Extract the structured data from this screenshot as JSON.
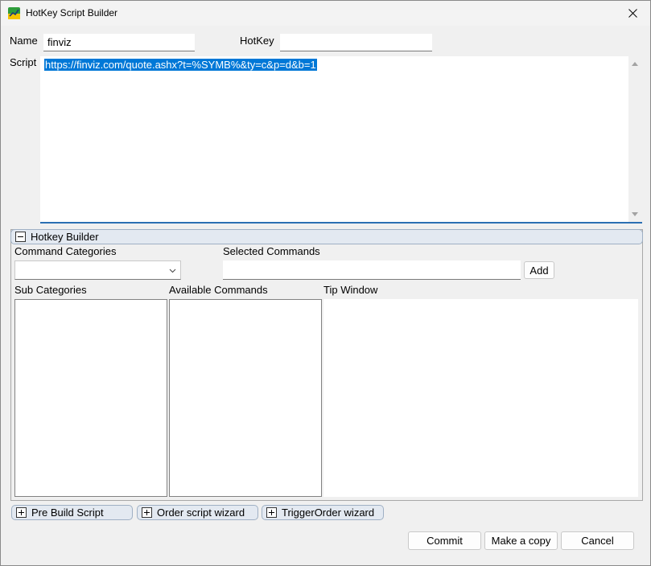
{
  "window": {
    "title": "HotKey Script Builder"
  },
  "form": {
    "name_label": "Name",
    "name_value": "finviz",
    "hotkey_label": "HotKey",
    "hotkey_value": "",
    "script_label": "Script",
    "script_value": "https://finviz.com/quote.ashx?t=%SYMB%&ty=c&p=d&b=1"
  },
  "builder": {
    "header_label": "Hotkey Builder",
    "command_categories_label": "Command Categories",
    "command_categories_selected": "",
    "selected_commands_label": "Selected Commands",
    "selected_commands_value": "",
    "add_label": "Add",
    "sub_categories_label": "Sub Categories",
    "available_commands_label": "Available Commands",
    "tip_window_label": "Tip Window"
  },
  "wizards": [
    {
      "label": "Pre Build Script"
    },
    {
      "label": "Order script wizard"
    },
    {
      "label": "TriggerOrder wizard"
    }
  ],
  "footer": {
    "commit_label": "Commit",
    "copy_label": "Make a copy",
    "cancel_label": "Cancel"
  },
  "colors": {
    "selection": "#0078d7",
    "header_bg": "#e3e9f1",
    "window_bg": "#f0f0f0"
  }
}
